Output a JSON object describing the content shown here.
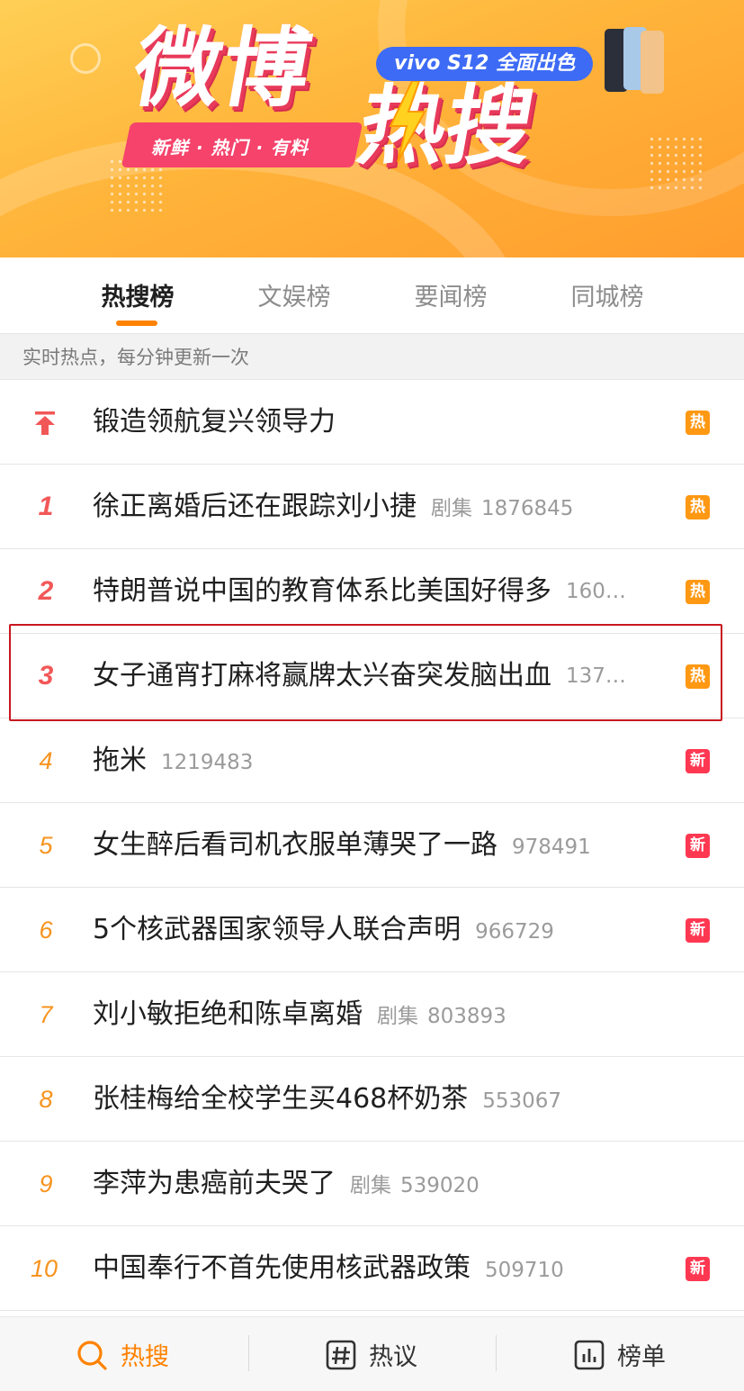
{
  "banner": {
    "title_part1": "微博",
    "title_part2": "热搜",
    "slogan": "新鲜 · 热门 · 有料",
    "ad_text": "vivo S12 全面出色"
  },
  "tabs": [
    {
      "label": "热搜榜",
      "active": true
    },
    {
      "label": "文娱榜",
      "active": false
    },
    {
      "label": "要闻榜",
      "active": false
    },
    {
      "label": "同城榜",
      "active": false
    }
  ],
  "subheading": "实时热点，每分钟更新一次",
  "list": [
    {
      "rank": "",
      "pinned": true,
      "topic": "锻造领航复兴领导力",
      "tag": "",
      "count": "",
      "badge": "热",
      "badge_type": "hot"
    },
    {
      "rank": "1",
      "pinned": false,
      "topic": "徐正离婚后还在跟踪刘小捷",
      "tag": "剧集",
      "count": "1876845",
      "badge": "热",
      "badge_type": "hot"
    },
    {
      "rank": "2",
      "pinned": false,
      "topic": "特朗普说中国的教育体系比美国好得多",
      "tag": "",
      "count": "160…",
      "badge": "热",
      "badge_type": "hot"
    },
    {
      "rank": "3",
      "pinned": false,
      "topic": "女子通宵打麻将赢牌太兴奋突发脑出血",
      "tag": "",
      "count": "137…",
      "badge": "热",
      "badge_type": "hot"
    },
    {
      "rank": "4",
      "pinned": false,
      "topic": "拖米",
      "tag": "",
      "count": "1219483",
      "badge": "新",
      "badge_type": "new"
    },
    {
      "rank": "5",
      "pinned": false,
      "topic": "女生醉后看司机衣服单薄哭了一路",
      "tag": "",
      "count": "978491",
      "badge": "新",
      "badge_type": "new"
    },
    {
      "rank": "6",
      "pinned": false,
      "topic": "5个核武器国家领导人联合声明",
      "tag": "",
      "count": "966729",
      "badge": "新",
      "badge_type": "new"
    },
    {
      "rank": "7",
      "pinned": false,
      "topic": "刘小敏拒绝和陈卓离婚",
      "tag": "剧集",
      "count": "803893",
      "badge": "",
      "badge_type": ""
    },
    {
      "rank": "8",
      "pinned": false,
      "topic": "张桂梅给全校学生买468杯奶茶",
      "tag": "",
      "count": "553067",
      "badge": "",
      "badge_type": ""
    },
    {
      "rank": "9",
      "pinned": false,
      "topic": "李萍为患癌前夫哭了",
      "tag": "剧集",
      "count": "539020",
      "badge": "",
      "badge_type": ""
    },
    {
      "rank": "10",
      "pinned": false,
      "topic": "中国奉行不首先使用核武器政策",
      "tag": "",
      "count": "509710",
      "badge": "新",
      "badge_type": "new"
    }
  ],
  "bottom_nav": [
    {
      "label": "热搜",
      "icon": "search-icon",
      "active": true
    },
    {
      "label": "热议",
      "icon": "hashtag-icon",
      "active": false
    },
    {
      "label": "榜单",
      "icon": "chart-icon",
      "active": false
    }
  ],
  "colors": {
    "accent": "#ff8200",
    "top_rank": "#f25757",
    "rank": "#f7931e",
    "badge_hot": "#ff9812",
    "badge_new": "#ff3852",
    "highlight_box": "#c8171f"
  }
}
